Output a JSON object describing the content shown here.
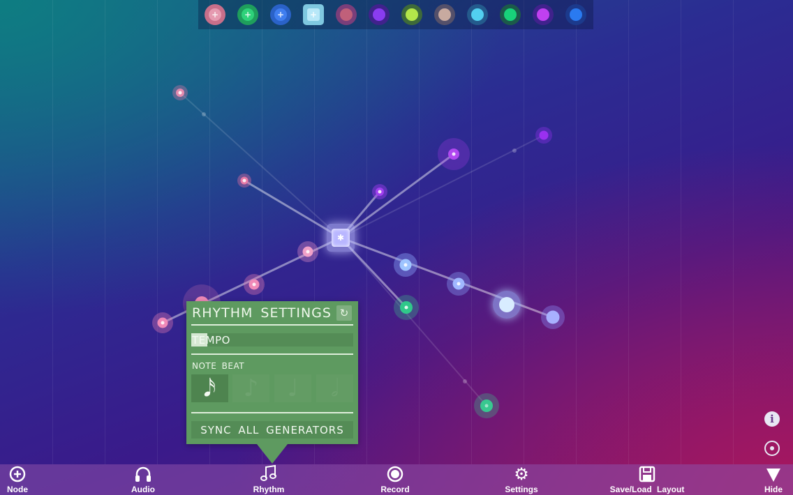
{
  "palette": {
    "items": [
      {
        "name": "pink-generator",
        "ring": "#c86f8a",
        "fill": "#e59ab0",
        "icon": "+"
      },
      {
        "name": "green-generator",
        "ring": "#1f9e5c",
        "fill": "#2ed27a",
        "icon": "+"
      },
      {
        "name": "blue-generator",
        "ring": "#2a62c8",
        "fill": "#3f7ef0",
        "icon": "+"
      },
      {
        "name": "square-generator",
        "ring": "#7fc8e0",
        "fill": "#b8e8f8",
        "icon": "+",
        "square": true
      },
      {
        "name": "rose-note",
        "ring": "#7a3e7a",
        "fill": "#c0607a"
      },
      {
        "name": "violet-note",
        "ring": "#40228c",
        "fill": "#8a3cf0"
      },
      {
        "name": "lime-note",
        "ring": "#3e6a3a",
        "fill": "#b4e64a"
      },
      {
        "name": "beige-note",
        "ring": "#54506a",
        "fill": "#c8aaa0"
      },
      {
        "name": "cyan-note",
        "ring": "#245a8c",
        "fill": "#52d0f0"
      },
      {
        "name": "emerald-note",
        "ring": "#1c5a4a",
        "fill": "#18d27a"
      },
      {
        "name": "purple-note",
        "ring": "#40228c",
        "fill": "#c040f0"
      },
      {
        "name": "azure-note",
        "ring": "#1c3a8c",
        "fill": "#2a7af0"
      }
    ]
  },
  "rhythm_panel": {
    "title": "RHYTHM SETTINGS",
    "tempo_label": "TEMPO",
    "tempo_level": 0.1,
    "note_beat_label": "NOTE BEAT",
    "beats": [
      {
        "glyph": "𝅘𝅥𝅯",
        "name": "sixteenth",
        "active": true
      },
      {
        "glyph": "♪",
        "name": "eighth",
        "active": false
      },
      {
        "glyph": "♩",
        "name": "quarter",
        "active": false
      },
      {
        "glyph": "𝅗𝅥",
        "name": "half",
        "active": false
      }
    ],
    "sync_label": "SYNC ALL GENERATORS"
  },
  "side_icons": {
    "info": "i",
    "target": "⊙"
  },
  "toolbar": {
    "node": "Node",
    "audio": "Audio",
    "rhythm": "Rhythm",
    "record": "Record",
    "settings": "Settings",
    "saveload": "Save/Load  Layout",
    "hide": "Hide"
  }
}
